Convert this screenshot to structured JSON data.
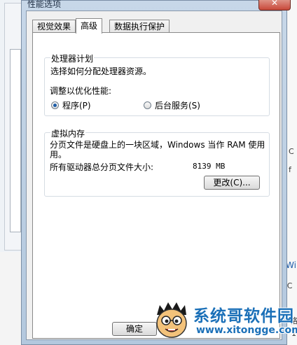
{
  "dialog": {
    "title": "性能选项",
    "close_glyph": "✕"
  },
  "tabs": [
    {
      "label": "视觉效果"
    },
    {
      "label": "高级"
    },
    {
      "label": "数据执行保护"
    }
  ],
  "processor": {
    "title": "处理器计划",
    "desc": "选择如何分配处理器资源。",
    "adjust_label": "调整以优化性能:",
    "opt_programs": "程序(P)",
    "opt_background": "后台服务(S)",
    "selected": "programs"
  },
  "vmem": {
    "title": "虚拟内存",
    "desc_line1": "分页文件是硬盘上的一块区域，Windows 当作 RAM 使用",
    "desc_line2": "用。",
    "total_label": "所有驱动器总分页文件大小:",
    "total_value": "8139 MB",
    "change_button": "更改(C)..."
  },
  "footer": {
    "ok_button": "确定"
  },
  "background": {
    "link_text": "Wi",
    "fragment_c": "C",
    "fragment_f": "f",
    "fragment_paren": ") C",
    "fragment_ge": "格",
    "fragment_n": "1"
  },
  "watermark": {
    "brand": "系统哥软件园",
    "url": "www.xitongge.com"
  }
}
